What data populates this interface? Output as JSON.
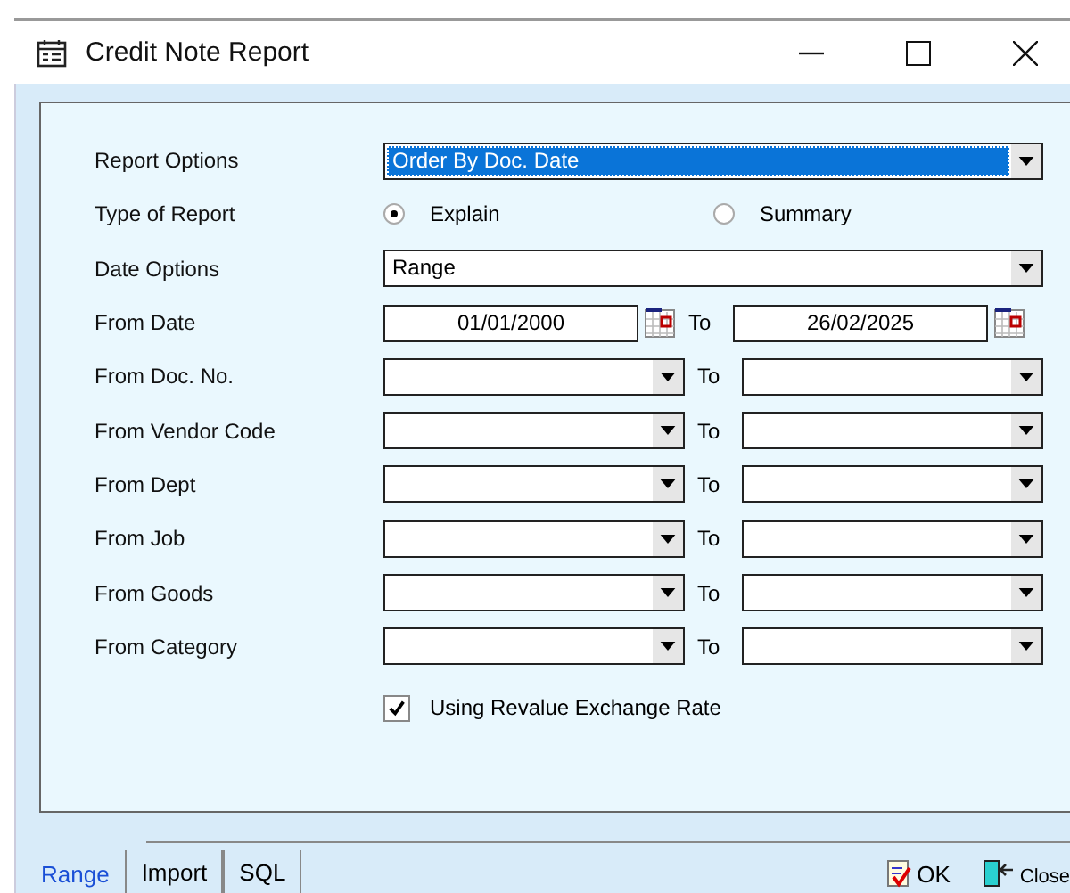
{
  "window": {
    "title": "Credit Note Report"
  },
  "rows": [
    {
      "kind": "combo",
      "label": "Report Options",
      "value": "Order By Doc. Date",
      "focused": true
    },
    {
      "kind": "radio",
      "label": "Type of Report",
      "options": [
        {
          "label": "Explain",
          "selected": true
        },
        {
          "label": "Summary",
          "selected": false
        }
      ]
    },
    {
      "kind": "combo",
      "label": "Date Options",
      "value": "Range",
      "focused": false
    },
    {
      "kind": "date_range",
      "label": "From Date",
      "from": "01/01/2000",
      "to_label": "To",
      "to": "26/02/2025"
    },
    {
      "kind": "range",
      "label": "From Doc. No.",
      "to_label": "To"
    },
    {
      "kind": "range",
      "label": "From Vendor Code",
      "to_label": "To"
    },
    {
      "kind": "range",
      "label": "From Dept",
      "to_label": "To"
    },
    {
      "kind": "range",
      "label": "From Job",
      "to_label": "To"
    },
    {
      "kind": "range",
      "label": "From Goods",
      "to_label": "To"
    },
    {
      "kind": "range",
      "label": "From Category",
      "to_label": "To"
    }
  ],
  "checkbox": {
    "label": "Using Revalue Exchange Rate",
    "checked": true
  },
  "tabs": [
    {
      "label": "Range",
      "selected": true
    },
    {
      "label": "Import",
      "selected": false
    },
    {
      "label": "SQL",
      "selected": false
    }
  ],
  "buttons": [
    {
      "kind": "ok",
      "label": "OK"
    },
    {
      "kind": "close",
      "label": "Close"
    }
  ]
}
